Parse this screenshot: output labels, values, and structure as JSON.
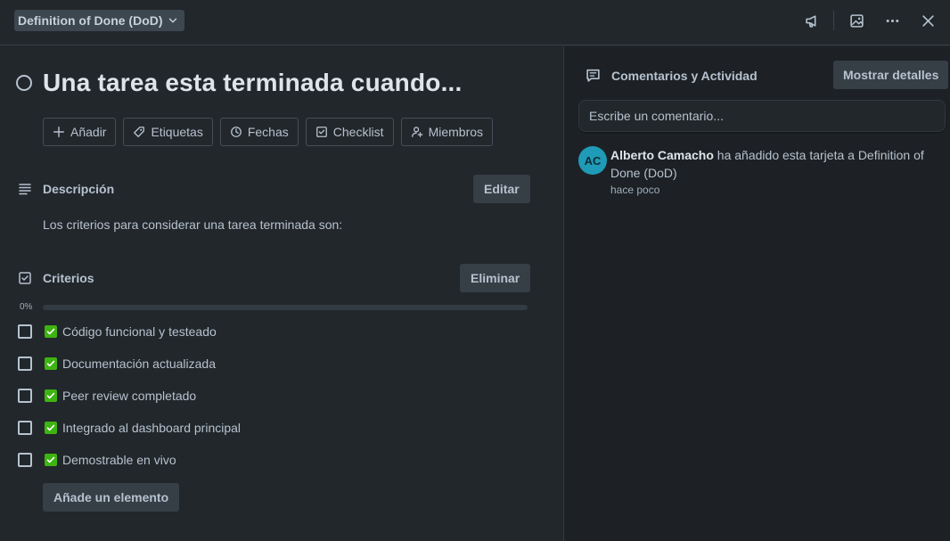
{
  "header": {
    "list_name": "Definition of Done (DoD)"
  },
  "card": {
    "title": "Una tarea esta terminada cuando..."
  },
  "actions": [
    {
      "label": "Añadir",
      "icon": "plus-icon"
    },
    {
      "label": "Etiquetas",
      "icon": "tag-icon"
    },
    {
      "label": "Fechas",
      "icon": "clock-icon"
    },
    {
      "label": "Checklist",
      "icon": "checkbox-icon"
    },
    {
      "label": "Miembros",
      "icon": "person-add-icon"
    }
  ],
  "description": {
    "heading": "Descripción",
    "edit_label": "Editar",
    "text": "Los criterios para considerar una tarea terminada son:"
  },
  "checklist": {
    "heading": "Criterios",
    "delete_label": "Eliminar",
    "progress": 0,
    "progress_label": "0%",
    "items": [
      {
        "text": "Código funcional y testeado",
        "checked": false
      },
      {
        "text": "Documentación actualizada",
        "checked": false
      },
      {
        "text": "Peer review completado",
        "checked": false
      },
      {
        "text": "Integrado al dashboard principal",
        "checked": false
      },
      {
        "text": "Demostrable en vivo",
        "checked": false
      }
    ],
    "add_item_label": "Añade un elemento"
  },
  "sidebar": {
    "heading": "Comentarios y Actividad",
    "show_details_label": "Mostrar detalles",
    "comment_placeholder": "Escribe un comentario...",
    "activity": {
      "avatar_initials": "AC",
      "user": "Alberto Camacho",
      "action": " ha añadido esta tarjeta a Definition of Done (DoD)",
      "time": "hace poco"
    }
  },
  "colors": {
    "background": "#22272b",
    "sidebar_background": "#1d2125",
    "button_gray": "#363e46",
    "avatar": "#1f9bb7",
    "emoji_check": "#3fb311"
  }
}
